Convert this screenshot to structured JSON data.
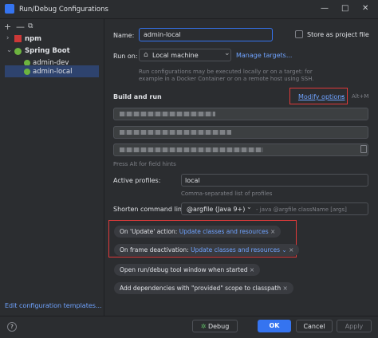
{
  "window": {
    "title": "Run/Debug Configurations",
    "minimize": "—",
    "maximize": "□",
    "close": "✕"
  },
  "toolbar": {
    "add": "+",
    "remove": "—",
    "copy": "⧉"
  },
  "tree": {
    "npm": "npm",
    "spring_boot": "Spring Boot",
    "items": [
      "admin-dev",
      "admin-local"
    ]
  },
  "left": {
    "edit_templates": "Edit configuration templates..."
  },
  "form": {
    "name_label": "Name:",
    "name_value": "admin-local",
    "store_label": "Store as project file",
    "run_on_label": "Run on:",
    "run_on_value": "Local machine",
    "manage_targets": "Manage targets...",
    "run_on_hint_1": "Run configurations may be executed locally or on a target: for",
    "run_on_hint_2": "example in a Docker Container or on a remote host using SSH.",
    "build_run_heading": "Build and run",
    "modify_options": "Modify options",
    "modify_shortcut": "Alt+M",
    "field_hint": "Press Alt for field hints",
    "active_profiles_label": "Active profiles:",
    "active_profiles_value": "local",
    "profiles_hint": "Comma-separated list of profiles",
    "shorten_label": "Shorten command line:",
    "shorten_value": "@argfile (Java 9+)",
    "shorten_desc": "- java @argfile className [args]"
  },
  "chips": {
    "update_label": "On 'Update' action:",
    "update_value": "Update classes and resources",
    "frame_label": "On frame deactivation:",
    "frame_value": "Update classes and resources",
    "tool_window": "Open run/debug tool window when started",
    "add_deps": "Add dependencies with \"provided\" scope to classpath"
  },
  "footer": {
    "help": "?",
    "debug": "Debug",
    "ok": "OK",
    "cancel": "Cancel",
    "apply": "Apply"
  },
  "colors": {
    "accent": "#3574f0",
    "link": "#6fa3ff",
    "highlight": "#e03a3a"
  }
}
